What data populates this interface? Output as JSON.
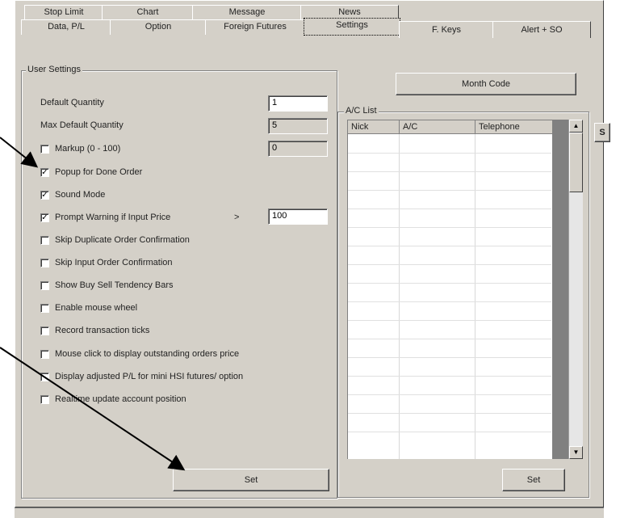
{
  "tabs_row1": [
    {
      "label": "Stop Limit"
    },
    {
      "label": "Chart"
    },
    {
      "label": "Message"
    },
    {
      "label": "News"
    }
  ],
  "tabs_row2": [
    {
      "label": "Data, P/L"
    },
    {
      "label": "Option"
    },
    {
      "label": "Foreign Futures"
    },
    {
      "label": "Settings"
    },
    {
      "label": "F. Keys"
    },
    {
      "label": "Alert + SO"
    }
  ],
  "user_settings": {
    "title": "User Settings",
    "default_quantity_label": "Default Quantity",
    "default_quantity_value": "1",
    "max_default_quantity_label": "Max Default Quantity",
    "max_default_quantity_value": "5",
    "markup_label": "Markup (0 - 100)",
    "markup_value": "0",
    "checkboxes": [
      {
        "label": "Popup for Done Order",
        "checked": true
      },
      {
        "label": "Sound Mode",
        "checked": true
      },
      {
        "label": "Prompt Warning if Input Price",
        "checked": true
      },
      {
        "label": "Skip Duplicate Order Confirmation",
        "checked": false
      },
      {
        "label": "Skip Input Order Confirmation",
        "checked": false
      },
      {
        "label": "Show Buy Sell Tendency Bars",
        "checked": false
      },
      {
        "label": "Enable mouse wheel",
        "checked": false
      },
      {
        "label": "Record transaction ticks",
        "checked": false
      },
      {
        "label": "Mouse click to display outstanding orders price",
        "checked": false
      },
      {
        "label": "Display adjusted P/L for mini HSI futures/ option",
        "checked": false
      },
      {
        "label": "Realtime update account position",
        "checked": false
      }
    ],
    "prompt_operator": ">",
    "prompt_value": "100",
    "set_label": "Set"
  },
  "month_code_label": "Month Code",
  "ac_list": {
    "title": "A/C List",
    "columns": [
      "Nick",
      "A/C",
      "Telephone"
    ],
    "set_label": "Set",
    "side_button_label": "S"
  },
  "colors": {
    "panel": "#d4d0c8",
    "scroll_thumb_track": "#808080"
  }
}
